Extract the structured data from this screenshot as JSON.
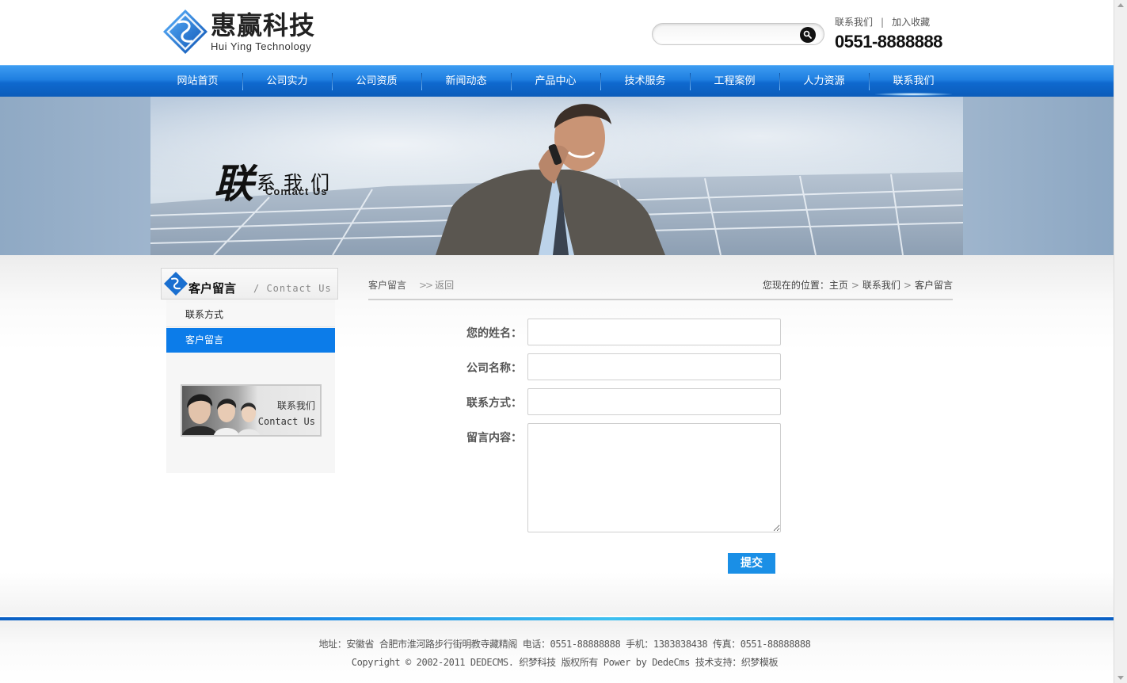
{
  "header": {
    "logo_cn": "惠赢科技",
    "logo_en": "Hui Ying Technology",
    "search_placeholder": "",
    "top_links": [
      "联系我们",
      "加入收藏"
    ],
    "separator": "|",
    "phone": "0551-8888888"
  },
  "nav": {
    "items": [
      "网站首页",
      "公司实力",
      "公司资质",
      "新闻动态",
      "产品中心",
      "技术服务",
      "工程案例",
      "人力资源",
      "联系我们"
    ],
    "active_index": 8
  },
  "banner": {
    "title_big": "联",
    "title_rest": "系我们",
    "title_en": "Contact Us"
  },
  "sidebar": {
    "heading_cn": "客户留言",
    "heading_en": "/ Contact Us",
    "items": [
      "联系方式",
      "客户留言"
    ],
    "active_index": 1,
    "card_cn": "联系我们",
    "card_en": "Contact Us"
  },
  "main": {
    "crumb_title": "客户留言",
    "crumb_back_chevron": ">>",
    "crumb_back": "返回",
    "location_label": "您现在的位置：",
    "path": [
      "主页",
      "联系我们",
      "客户留言"
    ],
    "path_separator": ">",
    "form": {
      "name_label": "您的姓名：",
      "name_value": "",
      "company_label": "公司名称：",
      "company_value": "",
      "contact_label": "联系方式：",
      "contact_value": "",
      "message_label": "留言内容：",
      "message_value": "",
      "submit_label": "提交"
    }
  },
  "footer": {
    "line1": "地址：安徽省 合肥市淮河路步行街明教寺藏精阁 电话：0551-88888888 手机：1383838438 传真：0551-88888888",
    "line2": "Copyright © 2002-2011 DEDECMS. 织梦科技 版权所有 Power by DedeCms 技术支持：织梦模板"
  },
  "colors": {
    "nav_blue": "#1f7fe0",
    "sidebar_active": "#0c7ce9",
    "submit_blue": "#1a8fe6",
    "footer_accent": "#3dc0f0"
  }
}
